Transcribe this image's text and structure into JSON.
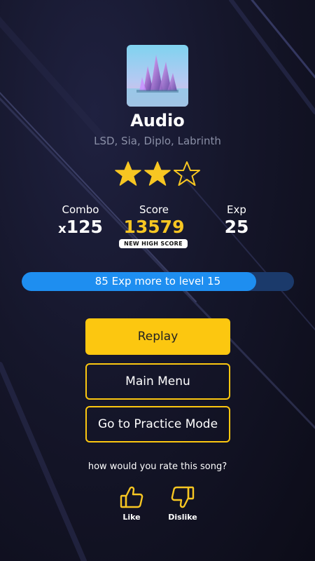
{
  "song": {
    "title": "Audio",
    "artists": "LSD, Sia, Diplo, Labrinth",
    "stars_earned": 2,
    "stars_total": 3
  },
  "stats": {
    "combo_label": "Combo",
    "combo_prefix": "x",
    "combo_value": "125",
    "score_label": "Score",
    "score_value": "13579",
    "high_score_badge": "NEW HIGH SCORE",
    "exp_label": "Exp",
    "exp_value": "25"
  },
  "progress": {
    "text": "85 Exp more to level 15",
    "fraction": 0.86
  },
  "buttons": {
    "replay": "Replay",
    "main_menu": "Main Menu",
    "practice": "Go to Practice Mode"
  },
  "rating": {
    "question": "how would you rate this song?",
    "like_label": "Like",
    "dislike_label": "Dislike"
  },
  "colors": {
    "accent_yellow": "#fcc710",
    "progress_fill": "#1e8ef0",
    "progress_track": "#1b3a6b",
    "background": "#15162a"
  }
}
